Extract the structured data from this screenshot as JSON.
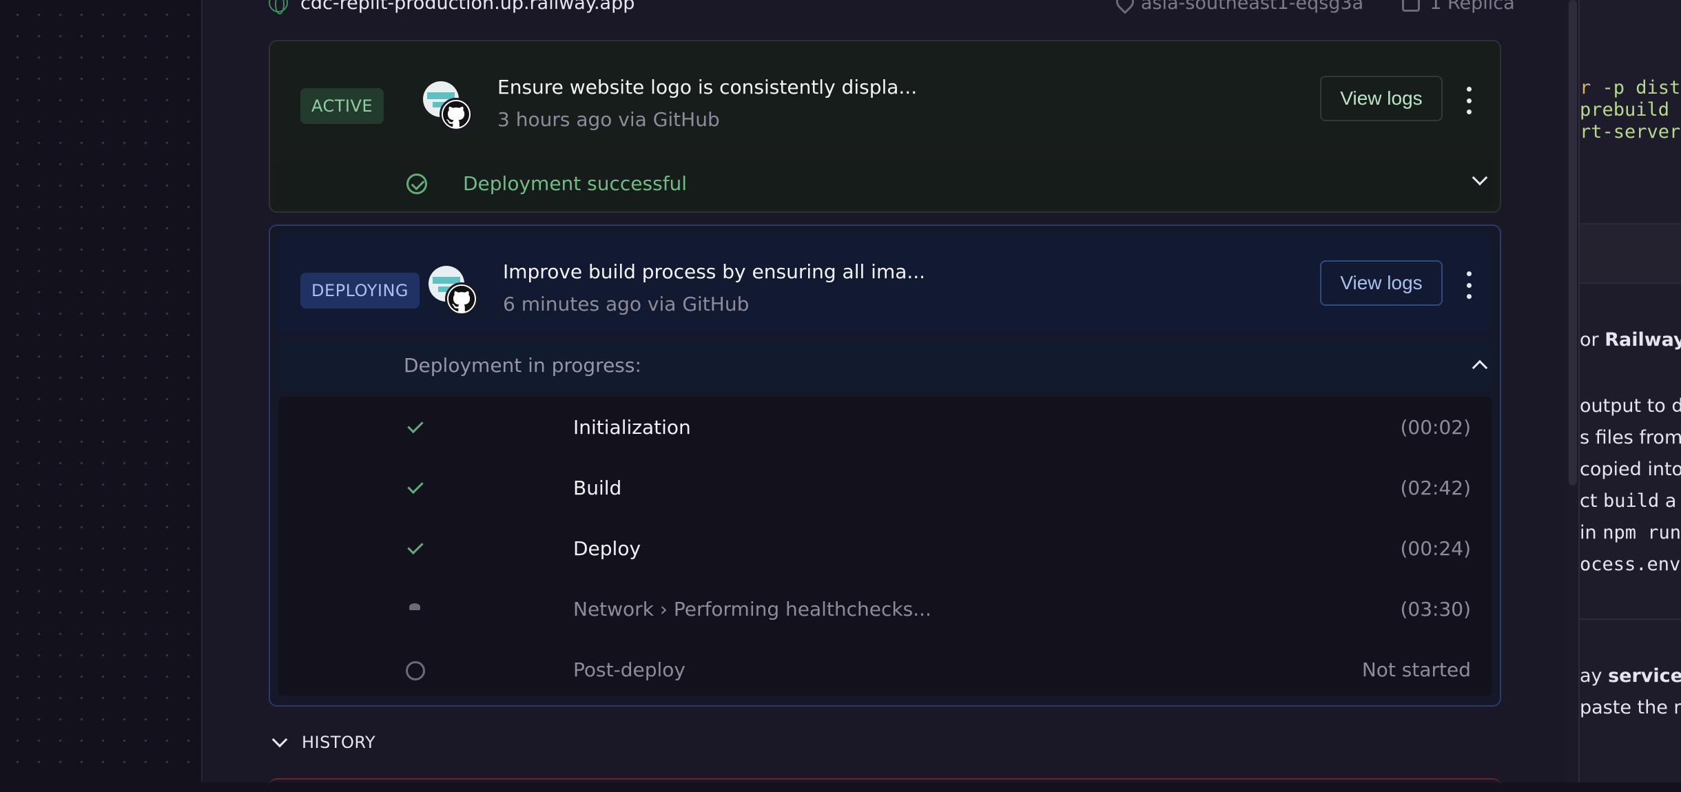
{
  "header": {
    "domain": "cdc-replit-production.up.railway.app",
    "region": "asia-southeast1-eqsg3a",
    "replicas": "1 Replica"
  },
  "deployments": [
    {
      "status": "ACTIVE",
      "message": "Ensure website logo is consistently displa...",
      "meta": "3 hours ago via GitHub",
      "view_logs_label": "View logs",
      "result": "Deployment successful"
    },
    {
      "status": "DEPLOYING",
      "message": "Improve build process by ensuring all ima...",
      "meta": "6 minutes ago via GitHub",
      "view_logs_label": "View logs",
      "progress_label": "Deployment in progress:",
      "steps": [
        {
          "label": "Initialization",
          "time": "(00:02)",
          "state": "done"
        },
        {
          "label": "Build",
          "time": "(02:42)",
          "state": "done"
        },
        {
          "label": "Deploy",
          "time": "(00:24)",
          "state": "done"
        },
        {
          "label": "Network › Performing healthchecks...",
          "time": "(03:30)",
          "state": "running"
        },
        {
          "label": "Post-deploy",
          "time": "Not started",
          "state": "not-started"
        }
      ]
    }
  ],
  "history_label": "HISTORY",
  "right_pane": {
    "code_lines": [
      " -p dist/",
      "prebuild",
      "rt-server"
    ],
    "heading_prefix": "or ",
    "heading_bold": "Railway",
    "lines": [
      "output to d",
      "s files from",
      "copied into",
      "ct ",
      "build",
      " a",
      "in ",
      "npm run",
      "ocess.env"
    ],
    "bottom_prefix": "ay ",
    "bottom_bold": "service.js",
    "bottom_line2": "paste the m"
  },
  "colors": {
    "success": "#5fae77",
    "deploying_accent": "#2a3a6a",
    "background": "#13111c"
  }
}
